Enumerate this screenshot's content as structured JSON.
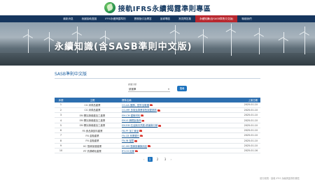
{
  "header": {
    "site_title": "接軌IFRS永續揭露準則專區"
  },
  "nav": {
    "items": [
      "最新消息",
      "我國接軌藍圖",
      "IFRS永續揭露準則",
      "實務指引及問答",
      "宣導專區",
      "常見問答集",
      "永續知識(含SASB準則中文版)",
      "聯絡我們"
    ],
    "active_index": 6
  },
  "hero": {
    "title": "永續知識(含SASB準則中文版)"
  },
  "section": {
    "title": "SASB準則中文版"
  },
  "filter": {
    "select_label": "產業分類",
    "select_value": "請選擇",
    "search_label": "搜尋"
  },
  "table": {
    "headers": [
      "序號",
      "主題",
      "標準名稱",
      "上架日期"
    ],
    "rows": [
      {
        "no": "1",
        "industry": "CG 消費品產業",
        "standard": "CG-AA 服飾、配件及鞋類",
        "date": "2025.01.10"
      },
      {
        "no": "2",
        "industry": "CG 消費品產業",
        "standard": "CG-MR 多樣及專業零售與配銷商",
        "date": "2025.01.10"
      },
      {
        "no": "3",
        "industry": "EM 開採與礦產加工產業",
        "standard": "EM-CM 建築材料",
        "date": "2025.01.10"
      },
      {
        "no": "4",
        "industry": "EM 開採與礦產加工產業",
        "standard": "EM-IS 鋼鐵製造商",
        "date": "2025.01.10"
      },
      {
        "no": "5",
        "industry": "EM 開採與礦產加工產業",
        "standard": "EM-RM 石油與天然氣-精煉與行銷",
        "date": "2025.01.10"
      },
      {
        "no": "6",
        "industry": "FB 食品與飲料產業",
        "standard": "FB-PF 加工食品",
        "date": "2025.01.10"
      },
      {
        "no": "7",
        "industry": "FN 金融產業",
        "standard": "FN-CB 商業銀行",
        "date": "2025.01.10"
      },
      {
        "no": "8",
        "industry": "FN 金融產業",
        "standard": "FN-IN 保險",
        "date": "2025.01.10"
      },
      {
        "no": "9",
        "industry": "HC 醫療保健產業",
        "standard": "HC-MS 醫療設備與用品",
        "date": "2025.01.10"
      },
      {
        "no": "10",
        "industry": "RT 資源轉化產業",
        "standard": "RT-CH 化學",
        "date": "2025.01.16"
      }
    ]
  },
  "pager": {
    "prev": "‹",
    "pages": [
      "1",
      "2",
      "3"
    ],
    "current": "1",
    "next": "›"
  },
  "footer": {
    "text": "觀行政院 · 接軌 IFRS 永續揭露準則專區"
  },
  "colors": {
    "nav_bg": "#16365e",
    "nav_active": "#b8282f",
    "table_header": "#2d6fb0",
    "accent": "#1e73be"
  }
}
